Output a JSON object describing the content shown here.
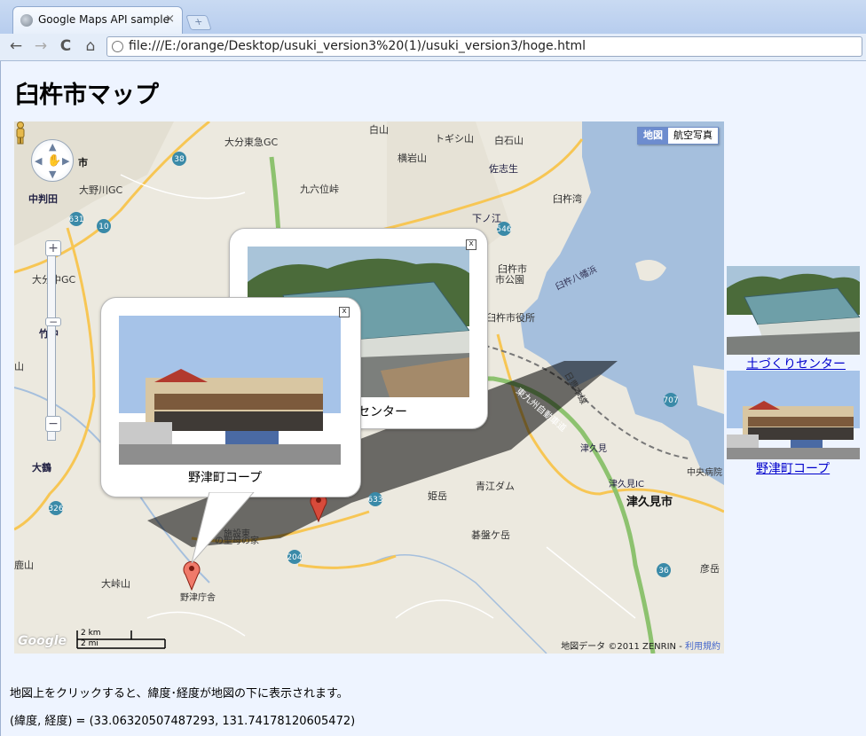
{
  "browser": {
    "tab_title": "Google Maps API sample",
    "tab_close": "×",
    "url": "file:///E:/orange/Desktop/usuki_version3%20(1)/usuki_version3/hoge.html",
    "nav": {
      "back": "←",
      "forward": "→",
      "reload": "C",
      "home": "⌂"
    }
  },
  "page": {
    "title": "臼杵市マップ",
    "instruction": "地図上をクリックすると、緯度･経度が地図の下に表示されます。",
    "latlng_text": "(緯度, 経度) = (33.06320507487293, 131.74178120605472)"
  },
  "map": {
    "map_type": {
      "map": "地図",
      "satellite": "航空写真"
    },
    "zoom_in": "+",
    "zoom_out": "−",
    "zoom_level": 12,
    "google_logo": "Google",
    "scale": {
      "km": "2 km",
      "mi": "2 mi"
    },
    "attribution": "地図データ ©2011 ZENRIN - ",
    "terms": "利用規約",
    "labels": [
      "大分東急GC",
      "白山",
      "トギシ山",
      "白石山",
      "横岩山",
      "佐志生",
      "九六位峠",
      "臼杵湾",
      "下ノ江",
      "臼杵市",
      "市公園",
      "臼杵市役所",
      "臼杵八幡浜",
      "日豊本線",
      "東九州自動車道",
      "津久見",
      "津久見IC",
      "津久見市",
      "中央病院",
      "大野川GC",
      "中判田",
      "大分中GC",
      "竹中",
      "大鶴",
      "重",
      "鹿山",
      "大峠山",
      "野津庁舎",
      "姫岳",
      "青江ダム",
      "碁盤ケ岳",
      "彦岳",
      "施設東",
      "の聖母の家",
      "山",
      "市"
    ],
    "route_numbers": [
      "38",
      "10",
      "631",
      "326",
      "633",
      "204",
      "546",
      "707",
      "36"
    ],
    "info_windows": [
      {
        "caption": "野津町コープ",
        "close": "x"
      },
      {
        "caption": "土づくりセンター",
        "caption_visible": "センター",
        "close": "x"
      }
    ]
  },
  "sidebar": {
    "items": [
      {
        "label": "土づくりセンター"
      },
      {
        "label": "野津町コープ"
      }
    ]
  },
  "colors": {
    "water": "#a5bfdd",
    "land": "#ece9df",
    "highway": "#8dc26f",
    "road": "#f7c654",
    "link": "#0000cc"
  }
}
